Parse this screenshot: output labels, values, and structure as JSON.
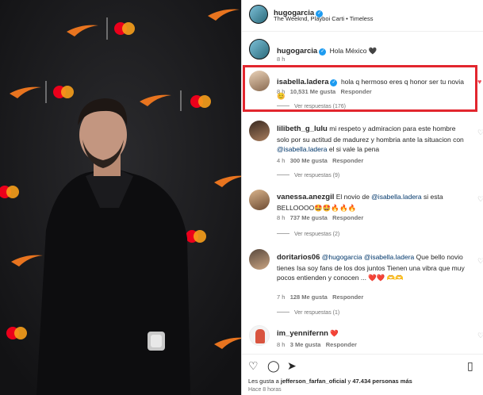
{
  "post": {
    "author": "hugogarcia",
    "audio": "The Weeknd, Playboi Carti • Timeless",
    "caption_text": "Hola México 🖤",
    "caption_time": "8 h"
  },
  "comments": [
    {
      "user": "isabella.ladera",
      "verified": true,
      "text": "hola q hermoso eres q honor ser tu novia 😊",
      "time": "8 h",
      "likes": "10,531 Me gusta",
      "reply": "Responder",
      "view_replies": "Ver respuestas (176)",
      "liked": true
    },
    {
      "user": "lilibeth_g_lulu",
      "verified": false,
      "text_before": "mi respeto y admiracion para este hombre solo por su actitud de madurez y hombria ante la situacion con",
      "mention": "@isabella.ladera",
      "text_after": "el si vale la pena",
      "time": "4 h",
      "likes": "300 Me gusta",
      "reply": "Responder",
      "view_replies": "Ver respuestas (9)"
    },
    {
      "user": "vanessa.anezgil",
      "verified": false,
      "text_before": "El novio de",
      "mention": "@isabella.ladera",
      "text_after": "si esta BELLOOOO🤩🤩🔥🔥🔥",
      "time": "8 h",
      "likes": "737 Me gusta",
      "reply": "Responder",
      "view_replies": "Ver respuestas (2)"
    },
    {
      "user": "doritarios06",
      "verified": false,
      "mention": "@hugogarcia @isabella.ladera",
      "text_after": "Que bello novio tienes Isa soy fans de los dos juntos Tienen una vibra que muy pocos entienden y conocen ... ❤️❤️ 🫶🫶",
      "time": "7 h",
      "likes": "128 Me gusta",
      "reply": "Responder",
      "view_replies": "Ver respuestas (1)"
    },
    {
      "user": "im_yennifernn",
      "verified": false,
      "text_after": "❤️",
      "time": "8 h",
      "likes": "3 Me gusta",
      "reply": "Responder"
    }
  ],
  "footer": {
    "likes_prefix": "Les gusta a",
    "likes_user": "jefferson_farfan_oficial",
    "likes_mid": "y",
    "likes_count": "47.434 personas más",
    "time": "Hace 8 horas"
  },
  "colors": {
    "highlight": "#e2262e",
    "link": "#00376b",
    "verified": "#1d9bf0",
    "heart": "#ed4956"
  }
}
